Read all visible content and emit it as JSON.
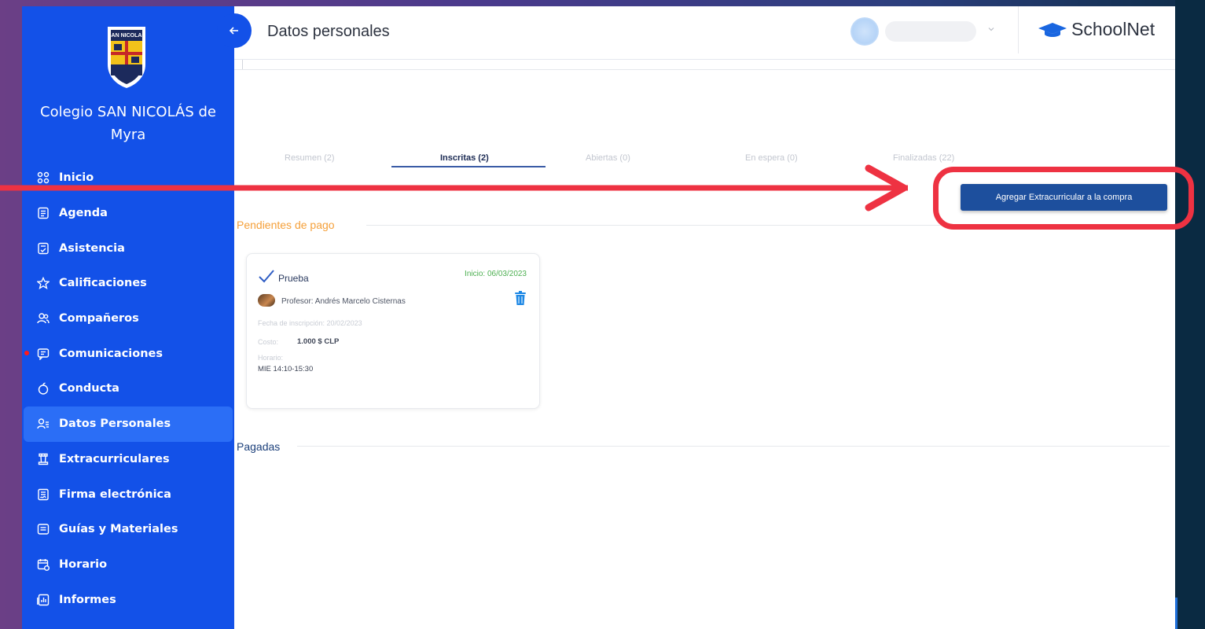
{
  "sidebar": {
    "school_name": "Colegio SAN NICOLÁS de Myra",
    "logo_text": "SAN NICOLAS",
    "items": [
      {
        "label": "Inicio",
        "icon": "grid-icon"
      },
      {
        "label": "Agenda",
        "icon": "document-icon"
      },
      {
        "label": "Asistencia",
        "icon": "checklist-icon"
      },
      {
        "label": "Calificaciones",
        "icon": "star-icon"
      },
      {
        "label": "Compañeros",
        "icon": "users-icon"
      },
      {
        "label": "Comunicaciones",
        "icon": "message-icon",
        "notification": true
      },
      {
        "label": "Conducta",
        "icon": "apple-icon"
      },
      {
        "label": "Datos Personales",
        "icon": "user-list-icon",
        "active": true
      },
      {
        "label": "Extracurriculares",
        "icon": "chess-rook-icon"
      },
      {
        "label": "Firma electrónica",
        "icon": "signature-icon"
      },
      {
        "label": "Guías y Materiales",
        "icon": "folder-icon"
      },
      {
        "label": "Horario",
        "icon": "calendar-icon"
      },
      {
        "label": "Informes",
        "icon": "report-icon"
      }
    ]
  },
  "header": {
    "title": "Datos personales",
    "brand": "SchoolNet"
  },
  "tabs": [
    {
      "label": "Resumen (2)"
    },
    {
      "label": "Inscritas (2)",
      "active": true
    },
    {
      "label": "Abiertas (0)"
    },
    {
      "label": "En espera (0)"
    },
    {
      "label": "Finalizadas (22)"
    }
  ],
  "actions": {
    "add_label": "Agregar Extracurricular a la compra"
  },
  "sections": {
    "pending": "Pendientes de pago",
    "paid": "Pagadas"
  },
  "card": {
    "title": "Prueba",
    "start": "Inicio: 06/03/2023",
    "teacher": "Profesor: Andrés Marcelo Cisternas",
    "enrollment_date": "Fecha de inscripción: 20/02/2023",
    "cost_label": "Costo:",
    "cost_value": "1.000 $ CLP",
    "schedule_label": "Horario:",
    "schedule_value": "MIE 14:10-15:30"
  },
  "colors": {
    "sidebar": "#1351e8",
    "sidebar_active": "#2b6ef6",
    "button": "#1d4f9d",
    "pending": "#f5a03a",
    "paid": "#1b3f7a",
    "start_date": "#4caf50",
    "annotation": "#ee3242"
  }
}
